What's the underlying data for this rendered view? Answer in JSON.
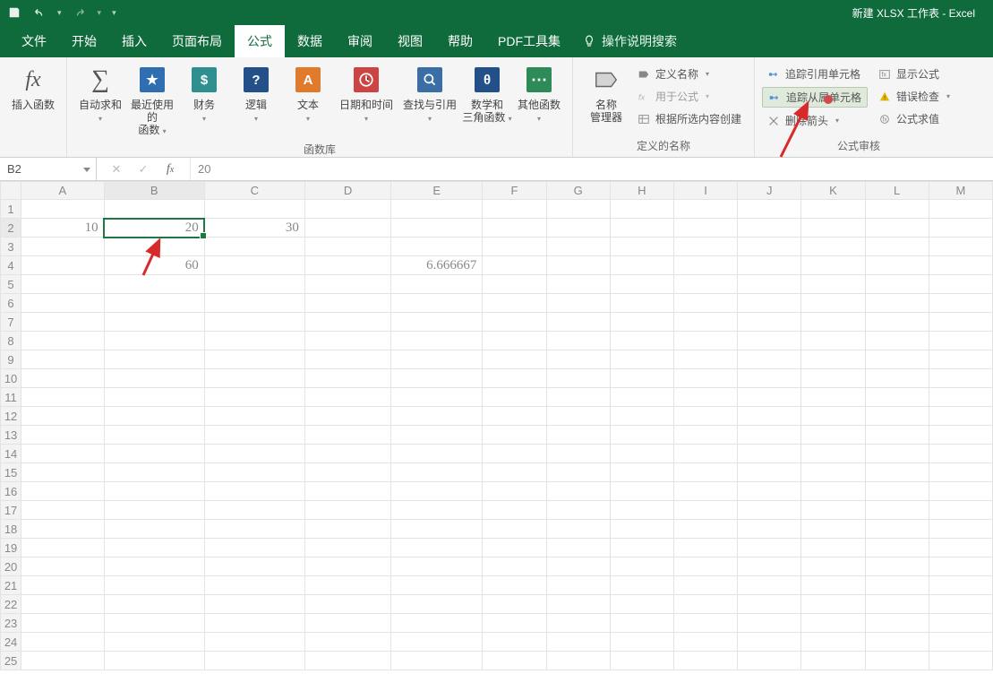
{
  "title": "新建 XLSX 工作表 - Excel",
  "qat": {
    "save": "save-icon",
    "undo": "undo-icon",
    "redo": "redo-icon",
    "custom": "▾"
  },
  "tabs": [
    "文件",
    "开始",
    "插入",
    "页面布局",
    "公式",
    "数据",
    "审阅",
    "视图",
    "帮助",
    "PDF工具集"
  ],
  "active_tab_index": 4,
  "tell_me": "操作说明搜索",
  "ribbon": {
    "insert_fn": "插入函数",
    "lib_group": "函数库",
    "lib": {
      "autosum": "自动求和",
      "recent": "最近使用的\n函数",
      "financial": "财务",
      "logical": "逻辑",
      "text": "文本",
      "datetime": "日期和时间",
      "lookup": "查找与引用",
      "mathtrig": "数学和\n三角函数",
      "more": "其他函数"
    },
    "names_group": "定义的名称",
    "names": {
      "mgr": "名称\n管理器",
      "define": "定义名称",
      "use": "用于公式",
      "create": "根据所选内容创建"
    },
    "audit_group": "公式审核",
    "audit": {
      "trace_prec": "追踪引用单元格",
      "trace_dep": "追踪从属单元格",
      "remove_arrows": "删除箭头",
      "show_formulas": "显示公式",
      "error_check": "错误检查",
      "evaluate": "公式求值"
    }
  },
  "formula_bar": {
    "name_box": "B2",
    "value": "20"
  },
  "columns": [
    "A",
    "B",
    "C",
    "D",
    "E",
    "F",
    "G",
    "H",
    "I",
    "J",
    "K",
    "L",
    "M"
  ],
  "rows": 25,
  "chart_data": {
    "type": "table",
    "cells": {
      "A2": "10",
      "B2": "20",
      "C2": "30",
      "B4": "60",
      "E4": "6.666667"
    },
    "selected": "B2"
  }
}
